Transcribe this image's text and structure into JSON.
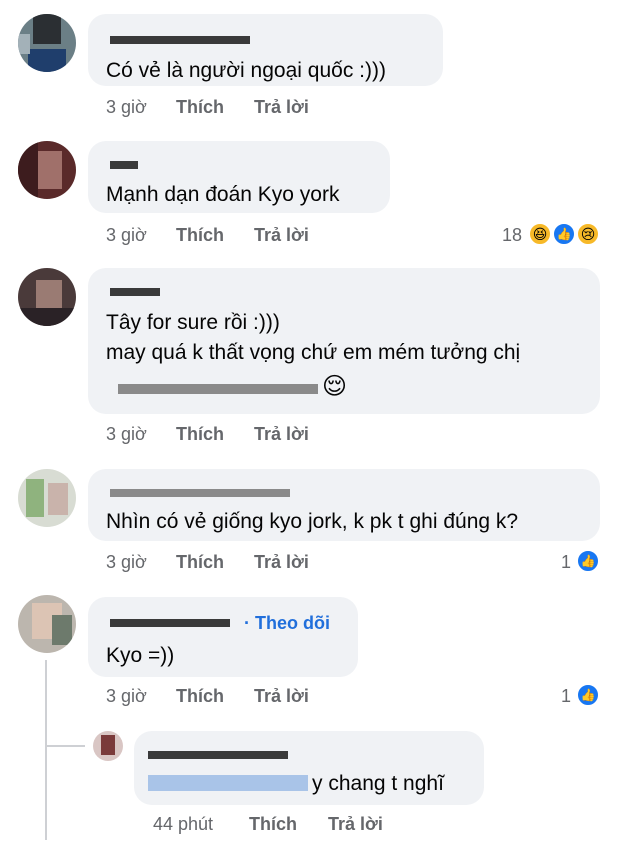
{
  "comments": [
    {
      "text": "Có vẻ là người ngoại quốc :)))",
      "time": "3 giờ",
      "like": "Thích",
      "reply": "Trả lời"
    },
    {
      "text": "Mạnh dạn đoán Kyo york",
      "time": "3 giờ",
      "like": "Thích",
      "reply": "Trả lời",
      "reaction_count": "18"
    },
    {
      "text1": "Tây for sure rồi :)))",
      "text2": "may quá k thất vọng chứ em mém tưởng chị",
      "emoji": "😌",
      "time": "3 giờ",
      "like": "Thích",
      "reply": "Trả lời"
    },
    {
      "text": "Nhìn có vẻ giống kyo jork, k pk t ghi đúng k?",
      "time": "3 giờ",
      "like": "Thích",
      "reply": "Trả lời",
      "reaction_count": "1"
    },
    {
      "follow": "· Theo dõi",
      "text": "Kyo =))",
      "time": "3 giờ",
      "like": "Thích",
      "reply": "Trả lời",
      "reaction_count": "1"
    }
  ],
  "reply": {
    "text": "y chang t nghĩ",
    "time": "44 phút",
    "like": "Thích",
    "reply": "Trả lời"
  },
  "icons": {
    "like": "👍",
    "haha": "😆",
    "sad": "😢"
  }
}
